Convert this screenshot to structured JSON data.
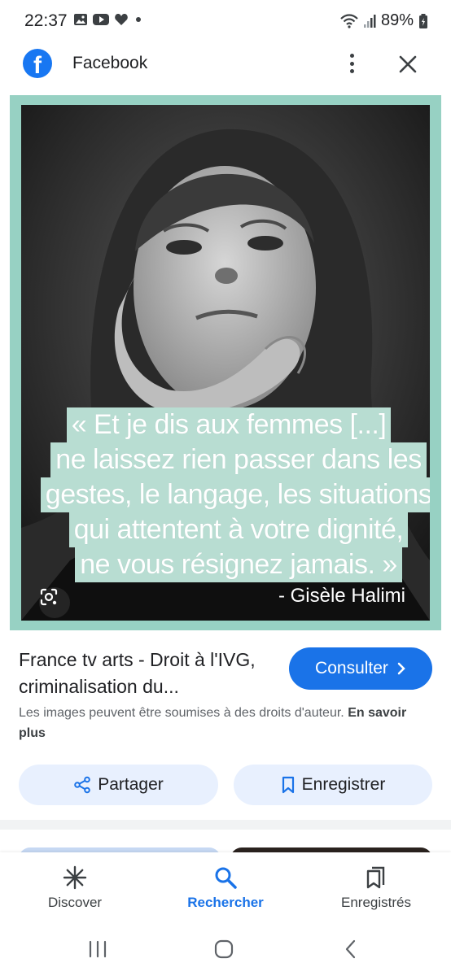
{
  "status_bar": {
    "time": "22:37",
    "battery": "89%",
    "icons_left": [
      "gallery-icon",
      "youtube-icon",
      "heart-icon",
      "dot-icon"
    ],
    "icons_right": [
      "wifi-icon",
      "signal-icon",
      "battery-icon"
    ]
  },
  "header": {
    "app_icon": "facebook-logo",
    "logo_letter": "f",
    "title": "Facebook",
    "more_icon": "more-vertical-icon",
    "close_icon": "close-icon"
  },
  "image": {
    "quote_lines": [
      "« Et je dis aux femmes [...]",
      "ne laissez rien passer dans les",
      "gestes, le langage, les situations",
      "qui attentent à votre dignité,",
      "ne vous résignez jamais. »"
    ],
    "author": "- Gisèle Halimi",
    "lens_icon": "google-lens-icon",
    "frame_color": "#97d1c3"
  },
  "result": {
    "title": "France tv arts - Droit à l'IVG, criminalisation du...",
    "consult_label": "Consulter",
    "copyright_text": "Les images peuvent être soumises à des droits d'auteur.",
    "learn_more": "En savoir plus"
  },
  "actions": {
    "share_label": "Partager",
    "save_label": "Enregistrer"
  },
  "bottom_nav": {
    "discover": "Discover",
    "search": "Rechercher",
    "saved": "Enregistrés",
    "active": "search"
  },
  "colors": {
    "accent": "#1a73e8",
    "pill_bg": "#e8f0fe",
    "facebook_blue": "#1877f2"
  }
}
